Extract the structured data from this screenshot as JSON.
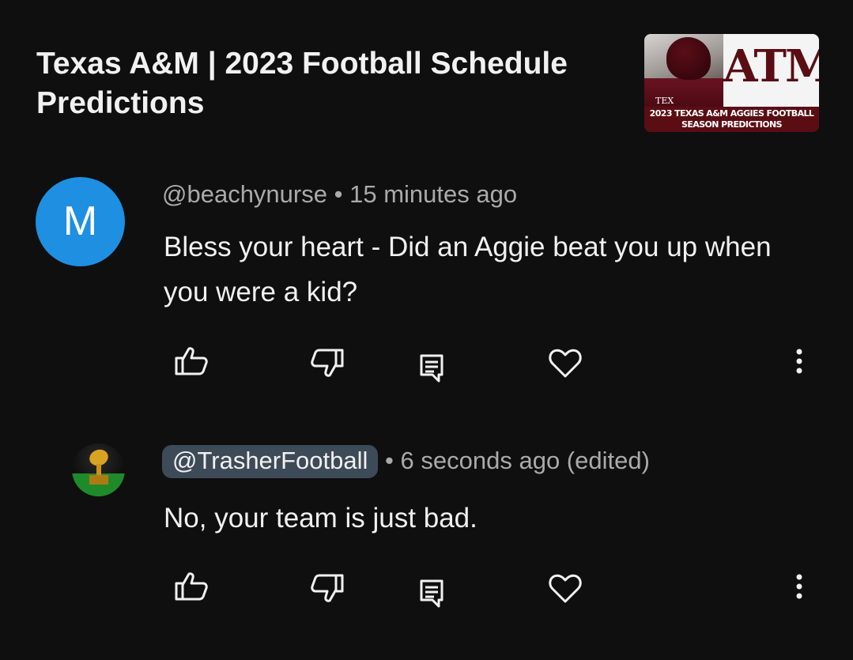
{
  "video": {
    "title": "Texas A&M | 2023 Football Schedule Predictions",
    "thumbnail": {
      "logo_text": "ATM",
      "tex_text": "TEX",
      "caption_line1": "2023 TEXAS A&M AGGIES FOOTBALL",
      "caption_line2": "SEASON PREDICTIONS"
    }
  },
  "comments": [
    {
      "avatar_letter": "M",
      "avatar_color": "#1e8fe1",
      "handle": "@beachynurse",
      "separator": "•",
      "time": "15 minutes ago",
      "text": "Bless your heart - Did an Aggie beat you up when you were a kid?",
      "icons": [
        "thumbs-up-icon",
        "thumbs-down-icon",
        "reply-icon",
        "heart-icon",
        "more-vert-icon"
      ]
    },
    {
      "avatar_letter": "",
      "handle": "@TrasherFootball",
      "separator": "•",
      "time": "6 seconds ago (edited)",
      "text": "No, your team is just bad.",
      "icons": [
        "thumbs-up-icon",
        "thumbs-down-icon",
        "reply-icon",
        "heart-icon",
        "more-vert-icon"
      ]
    }
  ],
  "colors": {
    "background": "#0f0f0f",
    "text_primary": "#f1f1f1",
    "text_secondary": "#aaaaaa",
    "handle_pill": "#3d4a57",
    "brand_maroon": "#5a0e14"
  }
}
